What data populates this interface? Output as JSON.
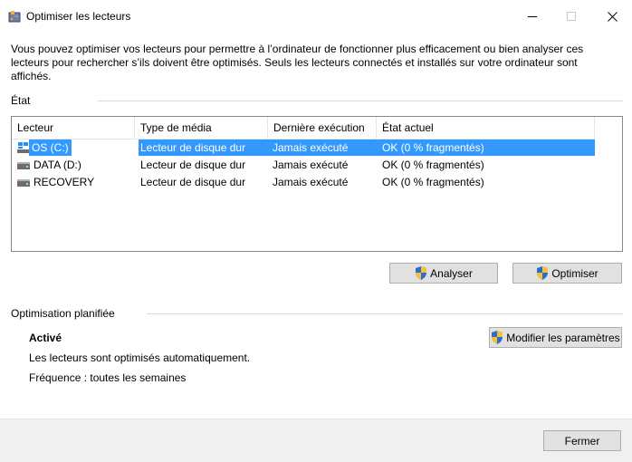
{
  "window": {
    "title": "Optimiser les lecteurs"
  },
  "description": "Vous pouvez optimiser vos lecteurs pour permettre à l’ordinateur de fonctionner plus efficacement ou bien analyser ces lecteurs pour rechercher s’ils doivent être optimisés. Seuls les lecteurs connectés et installés sur votre ordinateur sont affichés.",
  "status": {
    "group_label": "État",
    "columns": [
      "Lecteur",
      "Type de média",
      "Dernière exécution",
      "État actuel"
    ],
    "drives": [
      {
        "name": "OS (C:)",
        "media_type": "Lecteur de disque dur",
        "last_run": "Jamais exécuté",
        "state": "OK (0 % fragmentés)",
        "selected": true
      },
      {
        "name": "DATA (D:)",
        "media_type": "Lecteur de disque dur",
        "last_run": "Jamais exécuté",
        "state": "OK (0 % fragmentés)",
        "selected": false
      },
      {
        "name": "RECOVERY",
        "media_type": "Lecteur de disque dur",
        "last_run": "Jamais exécuté",
        "state": "OK (0 % fragmentés)",
        "selected": false
      }
    ]
  },
  "actions": {
    "analyze_label": "Analyser",
    "optimize_label": "Optimiser"
  },
  "scheduled": {
    "group_label": "Optimisation planifiée",
    "status": "Activé",
    "info": "Les lecteurs sont optimisés automatiquement.",
    "frequency": "Fréquence : toutes les semaines",
    "change_settings_label": "Modifier les paramètres"
  },
  "footer": {
    "close_label": "Fermer"
  },
  "colors": {
    "selection": "#3399ff",
    "button_face": "#e1e1e1",
    "footer_bg": "#f0f0f0"
  },
  "icons": {
    "app": "defrag-app-icon",
    "drive_system": "windows-drive-icon",
    "drive": "hard-drive-icon",
    "uac": "uac-shield-icon"
  }
}
